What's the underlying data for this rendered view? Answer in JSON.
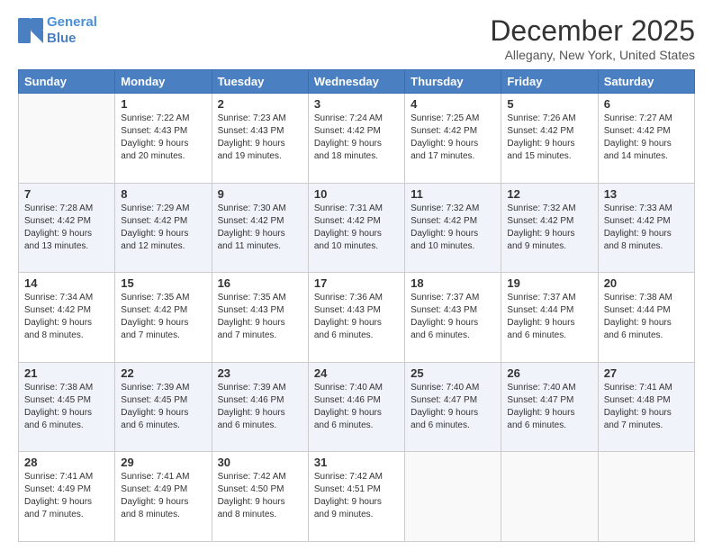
{
  "logo": {
    "line1": "General",
    "line2": "Blue"
  },
  "title": "December 2025",
  "subtitle": "Allegany, New York, United States",
  "days_of_week": [
    "Sunday",
    "Monday",
    "Tuesday",
    "Wednesday",
    "Thursday",
    "Friday",
    "Saturday"
  ],
  "weeks": [
    [
      {
        "day": "",
        "empty": true
      },
      {
        "day": "1",
        "sunrise": "Sunrise: 7:22 AM",
        "sunset": "Sunset: 4:43 PM",
        "daylight": "Daylight: 9 hours and 20 minutes."
      },
      {
        "day": "2",
        "sunrise": "Sunrise: 7:23 AM",
        "sunset": "Sunset: 4:43 PM",
        "daylight": "Daylight: 9 hours and 19 minutes."
      },
      {
        "day": "3",
        "sunrise": "Sunrise: 7:24 AM",
        "sunset": "Sunset: 4:42 PM",
        "daylight": "Daylight: 9 hours and 18 minutes."
      },
      {
        "day": "4",
        "sunrise": "Sunrise: 7:25 AM",
        "sunset": "Sunset: 4:42 PM",
        "daylight": "Daylight: 9 hours and 17 minutes."
      },
      {
        "day": "5",
        "sunrise": "Sunrise: 7:26 AM",
        "sunset": "Sunset: 4:42 PM",
        "daylight": "Daylight: 9 hours and 15 minutes."
      },
      {
        "day": "6",
        "sunrise": "Sunrise: 7:27 AM",
        "sunset": "Sunset: 4:42 PM",
        "daylight": "Daylight: 9 hours and 14 minutes."
      }
    ],
    [
      {
        "day": "7",
        "sunrise": "Sunrise: 7:28 AM",
        "sunset": "Sunset: 4:42 PM",
        "daylight": "Daylight: 9 hours and 13 minutes."
      },
      {
        "day": "8",
        "sunrise": "Sunrise: 7:29 AM",
        "sunset": "Sunset: 4:42 PM",
        "daylight": "Daylight: 9 hours and 12 minutes."
      },
      {
        "day": "9",
        "sunrise": "Sunrise: 7:30 AM",
        "sunset": "Sunset: 4:42 PM",
        "daylight": "Daylight: 9 hours and 11 minutes."
      },
      {
        "day": "10",
        "sunrise": "Sunrise: 7:31 AM",
        "sunset": "Sunset: 4:42 PM",
        "daylight": "Daylight: 9 hours and 10 minutes."
      },
      {
        "day": "11",
        "sunrise": "Sunrise: 7:32 AM",
        "sunset": "Sunset: 4:42 PM",
        "daylight": "Daylight: 9 hours and 10 minutes."
      },
      {
        "day": "12",
        "sunrise": "Sunrise: 7:32 AM",
        "sunset": "Sunset: 4:42 PM",
        "daylight": "Daylight: 9 hours and 9 minutes."
      },
      {
        "day": "13",
        "sunrise": "Sunrise: 7:33 AM",
        "sunset": "Sunset: 4:42 PM",
        "daylight": "Daylight: 9 hours and 8 minutes."
      }
    ],
    [
      {
        "day": "14",
        "sunrise": "Sunrise: 7:34 AM",
        "sunset": "Sunset: 4:42 PM",
        "daylight": "Daylight: 9 hours and 8 minutes."
      },
      {
        "day": "15",
        "sunrise": "Sunrise: 7:35 AM",
        "sunset": "Sunset: 4:42 PM",
        "daylight": "Daylight: 9 hours and 7 minutes."
      },
      {
        "day": "16",
        "sunrise": "Sunrise: 7:35 AM",
        "sunset": "Sunset: 4:43 PM",
        "daylight": "Daylight: 9 hours and 7 minutes."
      },
      {
        "day": "17",
        "sunrise": "Sunrise: 7:36 AM",
        "sunset": "Sunset: 4:43 PM",
        "daylight": "Daylight: 9 hours and 6 minutes."
      },
      {
        "day": "18",
        "sunrise": "Sunrise: 7:37 AM",
        "sunset": "Sunset: 4:43 PM",
        "daylight": "Daylight: 9 hours and 6 minutes."
      },
      {
        "day": "19",
        "sunrise": "Sunrise: 7:37 AM",
        "sunset": "Sunset: 4:44 PM",
        "daylight": "Daylight: 9 hours and 6 minutes."
      },
      {
        "day": "20",
        "sunrise": "Sunrise: 7:38 AM",
        "sunset": "Sunset: 4:44 PM",
        "daylight": "Daylight: 9 hours and 6 minutes."
      }
    ],
    [
      {
        "day": "21",
        "sunrise": "Sunrise: 7:38 AM",
        "sunset": "Sunset: 4:45 PM",
        "daylight": "Daylight: 9 hours and 6 minutes."
      },
      {
        "day": "22",
        "sunrise": "Sunrise: 7:39 AM",
        "sunset": "Sunset: 4:45 PM",
        "daylight": "Daylight: 9 hours and 6 minutes."
      },
      {
        "day": "23",
        "sunrise": "Sunrise: 7:39 AM",
        "sunset": "Sunset: 4:46 PM",
        "daylight": "Daylight: 9 hours and 6 minutes."
      },
      {
        "day": "24",
        "sunrise": "Sunrise: 7:40 AM",
        "sunset": "Sunset: 4:46 PM",
        "daylight": "Daylight: 9 hours and 6 minutes."
      },
      {
        "day": "25",
        "sunrise": "Sunrise: 7:40 AM",
        "sunset": "Sunset: 4:47 PM",
        "daylight": "Daylight: 9 hours and 6 minutes."
      },
      {
        "day": "26",
        "sunrise": "Sunrise: 7:40 AM",
        "sunset": "Sunset: 4:47 PM",
        "daylight": "Daylight: 9 hours and 6 minutes."
      },
      {
        "day": "27",
        "sunrise": "Sunrise: 7:41 AM",
        "sunset": "Sunset: 4:48 PM",
        "daylight": "Daylight: 9 hours and 7 minutes."
      }
    ],
    [
      {
        "day": "28",
        "sunrise": "Sunrise: 7:41 AM",
        "sunset": "Sunset: 4:49 PM",
        "daylight": "Daylight: 9 hours and 7 minutes."
      },
      {
        "day": "29",
        "sunrise": "Sunrise: 7:41 AM",
        "sunset": "Sunset: 4:49 PM",
        "daylight": "Daylight: 9 hours and 8 minutes."
      },
      {
        "day": "30",
        "sunrise": "Sunrise: 7:42 AM",
        "sunset": "Sunset: 4:50 PM",
        "daylight": "Daylight: 9 hours and 8 minutes."
      },
      {
        "day": "31",
        "sunrise": "Sunrise: 7:42 AM",
        "sunset": "Sunset: 4:51 PM",
        "daylight": "Daylight: 9 hours and 9 minutes."
      },
      {
        "day": "",
        "empty": true
      },
      {
        "day": "",
        "empty": true
      },
      {
        "day": "",
        "empty": true
      }
    ]
  ]
}
